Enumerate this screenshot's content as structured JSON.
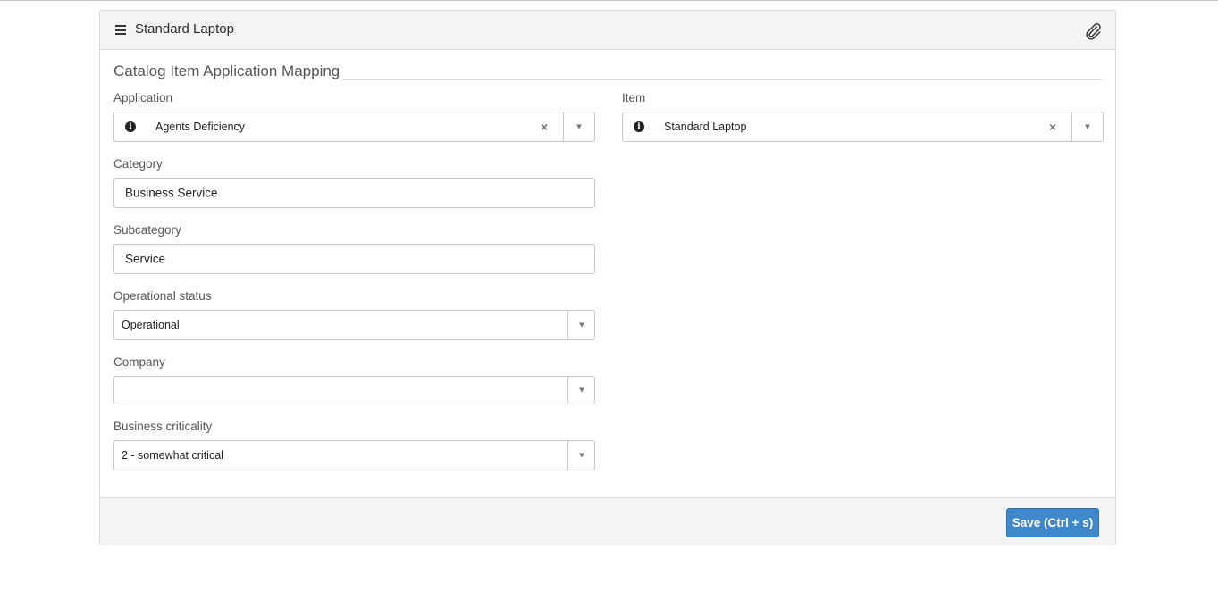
{
  "header": {
    "title": "Standard Laptop",
    "menu_icon": "hamburger-icon",
    "attach_icon": "paperclip-icon"
  },
  "section": {
    "title": "Catalog Item Application Mapping"
  },
  "fields": {
    "application": {
      "label": "Application",
      "value": "Agents Deficiency"
    },
    "item": {
      "label": "Item",
      "value": "Standard Laptop"
    },
    "category": {
      "label": "Category",
      "value": "Business Service"
    },
    "subcategory": {
      "label": "Subcategory",
      "value": "Service"
    },
    "operational_status": {
      "label": "Operational status",
      "value": "Operational"
    },
    "company": {
      "label": "Company",
      "value": ""
    },
    "business_criticality": {
      "label": "Business criticality",
      "value": "2 - somewhat critical"
    }
  },
  "footer": {
    "save_label": "Save (Ctrl + s)"
  },
  "colors": {
    "primary_button": "#3f88cc",
    "header_bg": "#f4f4f4",
    "border": "#c6c6c6"
  }
}
